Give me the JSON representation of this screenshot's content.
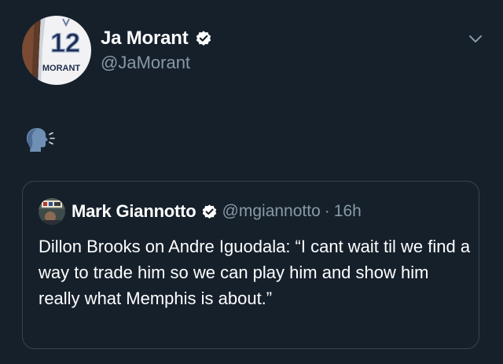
{
  "tweet": {
    "author_name": "Ja Morant",
    "author_handle": "@JaMorant",
    "avatar_jersey_number": "12",
    "avatar_jersey_name": "MORANT",
    "emoji_icon": "speaking-head-icon",
    "menu_icon": "chevron-down-icon"
  },
  "quoted_tweet": {
    "author_name": "Mark Giannotto",
    "author_handle": "@mgiannotto",
    "separator": "·",
    "time": "16h",
    "text": "Dillon Brooks on Andre Iguodala: “I cant wait til we find a way to trade him so we can play him and show him really what Memphis is about.”"
  },
  "colors": {
    "background": "#15202b",
    "primary_text": "#ffffff",
    "secondary_text": "#8899a6",
    "border": "#38444d",
    "verified_badge": "#ffffff"
  }
}
